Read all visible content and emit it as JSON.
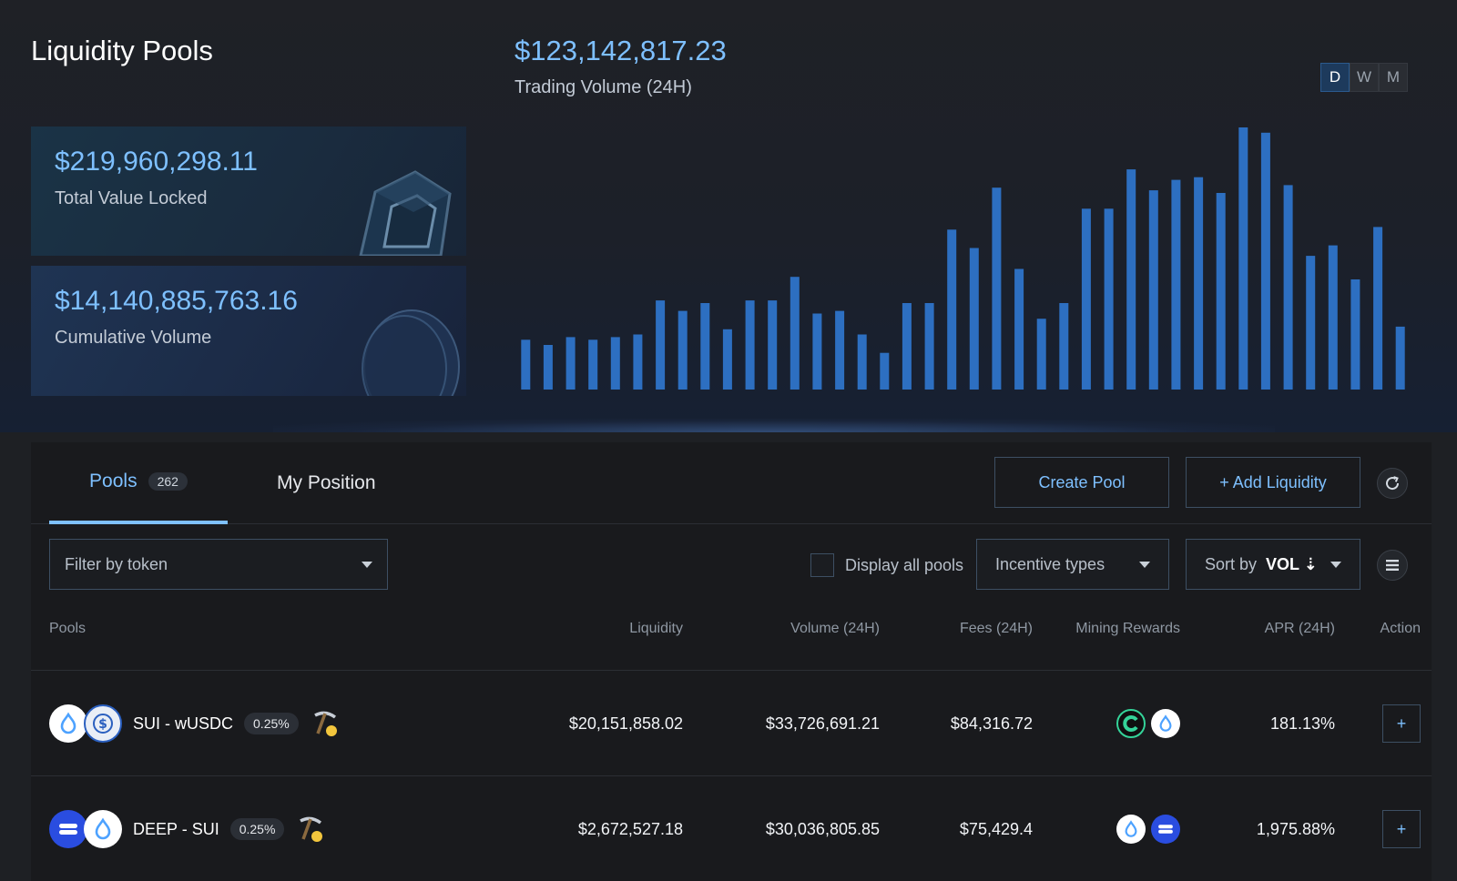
{
  "title": "Liquidity Pools",
  "stats": {
    "tvl_value": "$219,960,298.11",
    "tvl_label": "Total Value Locked",
    "cumulative_value": "$14,140,885,763.16",
    "cumulative_label": "Cumulative Volume",
    "volume_value": "$123,142,817.23",
    "volume_label": "Trading Volume (24H)"
  },
  "period": {
    "options": [
      "D",
      "W",
      "M"
    ],
    "selected": "D"
  },
  "chart_data": {
    "type": "bar",
    "title": "",
    "xlabel": "",
    "ylabel": "",
    "ylim": [
      0,
      100
    ],
    "grid": false,
    "color": "#2d6fc1",
    "values": [
      19,
      17,
      20,
      19,
      20,
      21,
      34,
      30,
      33,
      23,
      34,
      34,
      43,
      29,
      30,
      21,
      14,
      33,
      33,
      61,
      54,
      77,
      46,
      27,
      33,
      69,
      69,
      84,
      76,
      80,
      81,
      75,
      100,
      98,
      78,
      51,
      55,
      42,
      62,
      24
    ]
  },
  "tabs": {
    "pools_label": "Pools",
    "pools_count": "262",
    "position_label": "My Position"
  },
  "actions": {
    "create_pool": "Create Pool",
    "add_liquidity": "+ Add Liquidity"
  },
  "filters": {
    "token_placeholder": "Filter by token",
    "display_all": "Display all pools",
    "incentive": "Incentive types",
    "sort_label": "Sort by",
    "sort_value": "VOL ⇣"
  },
  "columns": {
    "pools": "Pools",
    "liquidity": "Liquidity",
    "volume": "Volume (24H)",
    "fees": "Fees (24H)",
    "rewards": "Mining Rewards",
    "apr": "APR (24H)",
    "action": "Action"
  },
  "rows": [
    {
      "pair": "SUI - wUSDC",
      "fee": "0.25%",
      "liquidity": "$20,151,858.02",
      "volume": "$33,726,691.21",
      "fees": "$84,316.72",
      "apr": "181.13%",
      "action": "+"
    },
    {
      "pair": "DEEP - SUI",
      "fee": "0.25%",
      "liquidity": "$2,672,527.18",
      "volume": "$30,036,805.85",
      "fees": "$75,429.4",
      "apr": "1,975.88%",
      "action": "+"
    }
  ],
  "colors": {
    "accent": "#7ec0ff",
    "bar": "#2d6fc1",
    "sui": "#4da2ff",
    "deep": "#2a4de0"
  }
}
